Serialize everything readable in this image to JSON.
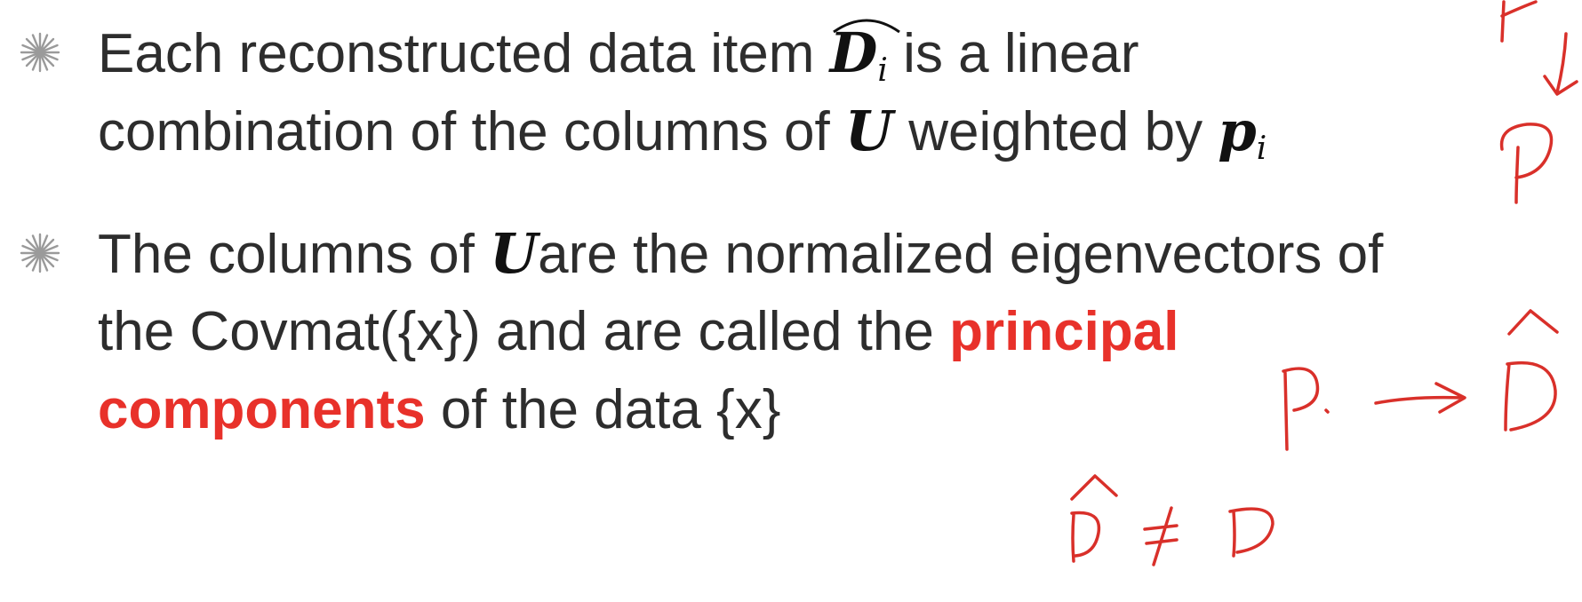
{
  "slide": {
    "bullets": [
      {
        "lines": [
          {
            "pre": "Each reconstructed data item ",
            "math": "D",
            "math_sub": "i",
            "math_hat": true,
            "post": " is a linear"
          },
          {
            "pre": "combination of the columns of ",
            "math": "U",
            "post": " weighted by ",
            "math2": "p",
            "math2_sub": "i"
          }
        ]
      },
      {
        "lines": [
          {
            "pre": "The columns of  ",
            "math": "U",
            "post": "are the normalized eigenvectors of"
          },
          {
            "pre": "the Covmat({x}) and are called the ",
            "emph": "principal"
          },
          {
            "emph": "components",
            "post": " of the data {x}"
          }
        ]
      }
    ],
    "bullet_icon": "starburst-bullet-icon",
    "colors": {
      "text": "#2d2d2d",
      "emphasis": "#e8312a",
      "annotation_ink": "#d9302a"
    }
  }
}
